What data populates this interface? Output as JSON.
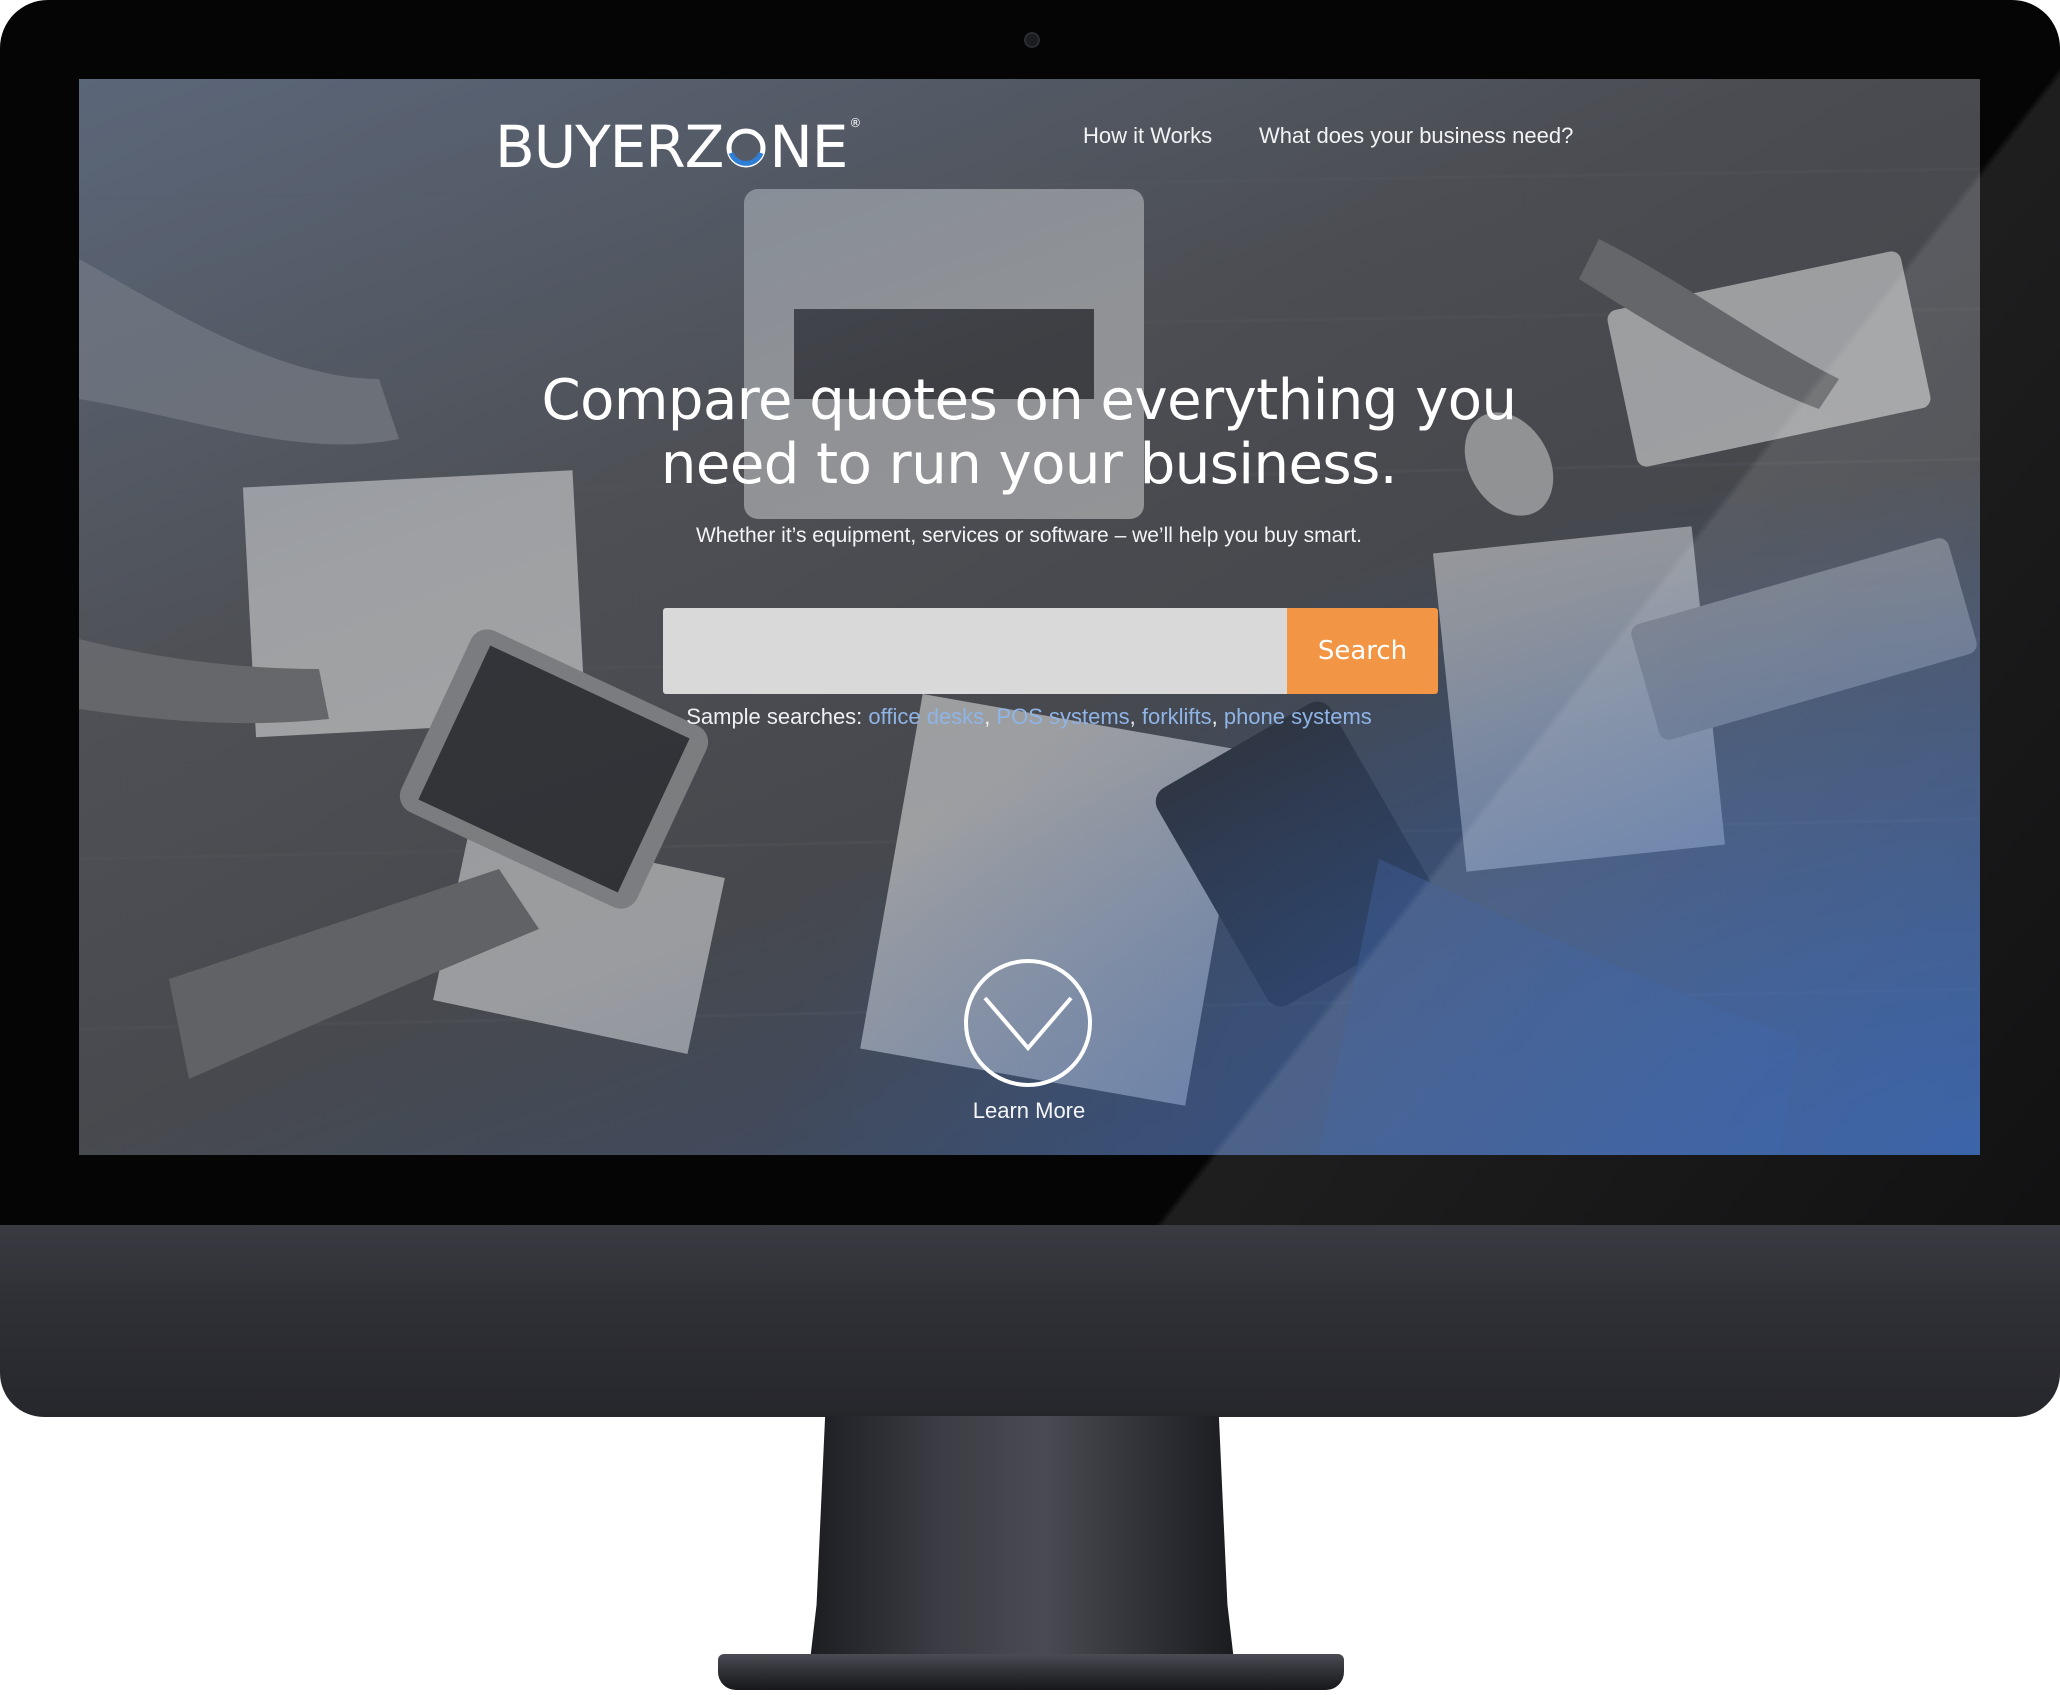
{
  "brand": {
    "logo_prefix": "BUYERZ",
    "logo_suffix": "NE",
    "logo_registered": "®",
    "accent_color": "#2f7fd6"
  },
  "nav": {
    "how_it_works": "How it Works",
    "business_need": "What does your business need?"
  },
  "hero": {
    "headline_line1": "Compare quotes on everything you",
    "headline_line2": "need to run your business.",
    "subheadline": "Whether it’s equipment, services or software – we’ll help you buy smart."
  },
  "search": {
    "input_value": "",
    "placeholder": "",
    "button_label": "Search",
    "button_color": "#f29544"
  },
  "samples": {
    "prefix": "Sample searches: ",
    "items": [
      "office desks",
      "POS systems",
      "forklifts",
      "phone systems"
    ],
    "link_color": "#8fb4e6"
  },
  "learn_more": {
    "label": "Learn More",
    "icon": "chevron-down-circle-icon"
  }
}
